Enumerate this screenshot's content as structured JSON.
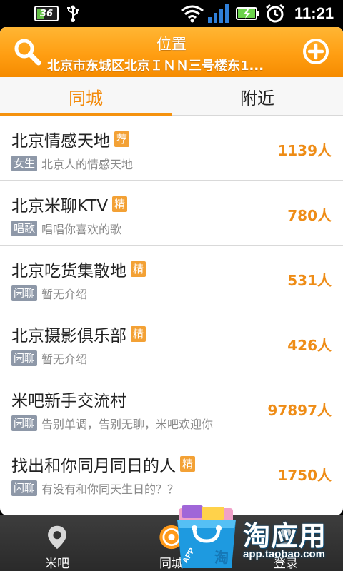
{
  "status_bar": {
    "battery_small": "36",
    "time": "11:21",
    "icons": [
      "usb-icon",
      "wifi-icon",
      "signal-icon",
      "battery-charging-icon",
      "alarm-icon"
    ]
  },
  "header": {
    "title": "位置",
    "address": "北京市东城区北京ＩＮＮ三号楼东1...",
    "icons": [
      "search-icon",
      "add-circle-icon"
    ],
    "accent_color": "#ff9e12"
  },
  "tabs": [
    {
      "label": "同城",
      "active": true
    },
    {
      "label": "附近",
      "active": false
    }
  ],
  "rooms": [
    {
      "name": "北京情感天地",
      "tag": "荐",
      "category": "女生",
      "desc": "北京人的情感天地",
      "count": "1139人"
    },
    {
      "name": "北京米聊KTV",
      "tag": "精",
      "category": "唱歌",
      "desc": "唱唱你喜欢的歌",
      "count": "780人"
    },
    {
      "name": "北京吃货集散地",
      "tag": "精",
      "category": "闲聊",
      "desc": "暂无介绍",
      "count": "531人"
    },
    {
      "name": "北京摄影俱乐部",
      "tag": "精",
      "category": "闲聊",
      "desc": "暂无介绍",
      "count": "426人"
    },
    {
      "name": "米吧新手交流村",
      "tag": "",
      "category": "闲聊",
      "desc": "告别单调，告别无聊，米吧欢迎你",
      "count": "97897人"
    },
    {
      "name": "找出和你同月同日的人",
      "tag": "精",
      "category": "闲聊",
      "desc": "有没有和你同天生日的？？",
      "count": "1750人"
    }
  ],
  "bottom_nav": [
    {
      "label": "米吧",
      "icon": "location-pin-icon"
    },
    {
      "label": "同城",
      "icon": "target-icon"
    },
    {
      "label": "登录",
      "icon": "user-icon"
    }
  ],
  "watermark": {
    "title": "淘应用",
    "url": "app.taobao.com",
    "bag_text": "APP",
    "bag_char": "淘"
  },
  "colors": {
    "tag": "#f3a135",
    "category": "#8e98a8",
    "count": "#ee8c16"
  }
}
